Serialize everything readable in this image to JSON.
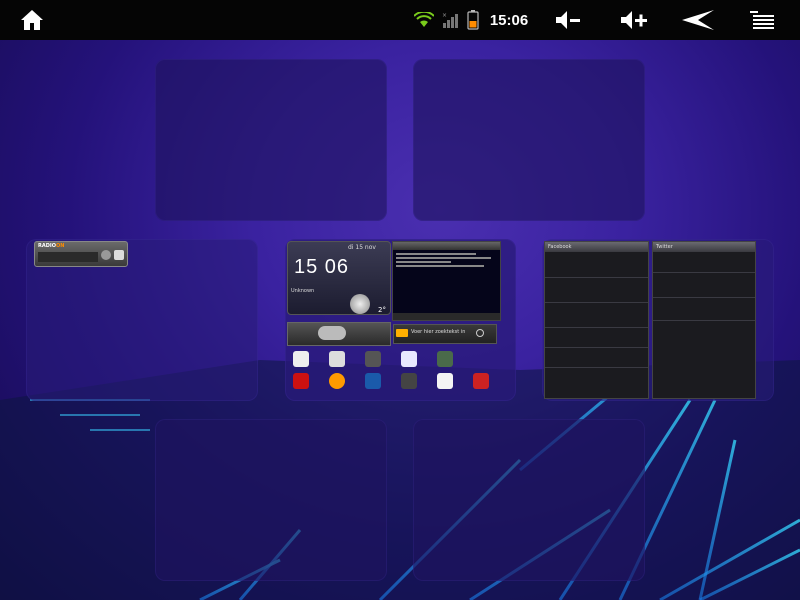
{
  "status_bar": {
    "clock": "15:06",
    "icons": [
      "home-icon",
      "wifi-icon",
      "signal-icon",
      "battery-icon",
      "volume-down-icon",
      "volume-up-icon",
      "back-icon",
      "menu-icon"
    ],
    "battery_color": "#ff8c00",
    "wifi_color": "#7acc1c"
  },
  "home_panels": {
    "center": {
      "clock_time": "15 06",
      "date": "di 15 nov",
      "location": "Unknown",
      "temperature": "2°",
      "search_text": "Voer hier zoektekst in",
      "news_title": "",
      "news_body": ""
    },
    "left": {
      "widget_brand": "RADIO",
      "widget_brand_accent": "ON"
    },
    "right": {
      "facebook_header": "Facebook",
      "twitter_header": "Twitter"
    }
  },
  "colors": {
    "accent": "#3a22a0",
    "beam": "#1ea7ff"
  }
}
